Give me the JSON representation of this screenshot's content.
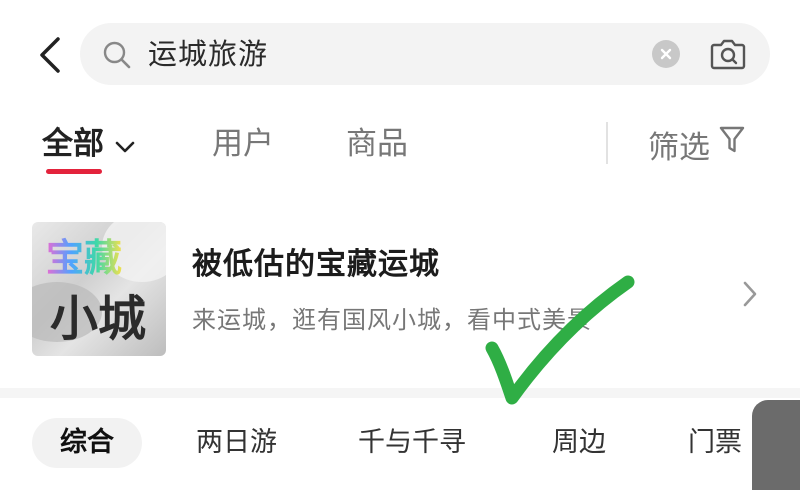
{
  "search": {
    "query": "运城旅游"
  },
  "tabs": {
    "all": "全部",
    "users": "用户",
    "products": "商品",
    "filter": "筛选"
  },
  "topic_card": {
    "thumb_line1": "宝藏",
    "thumb_line2": "小城",
    "title": "被低估的宝藏运城",
    "subtitle": "来运城，逛有国风小城，看中式美景"
  },
  "chips": [
    "综合",
    "两日游",
    "千与千寻",
    "周边",
    "门票"
  ],
  "colors": {
    "accent": "#e3233c",
    "check_mark": "#2fae45"
  },
  "icons": [
    "back-arrow-icon",
    "search-icon",
    "clear-icon",
    "camera-icon",
    "chevron-down-icon",
    "filter-funnel-icon",
    "chevron-right-icon"
  ]
}
